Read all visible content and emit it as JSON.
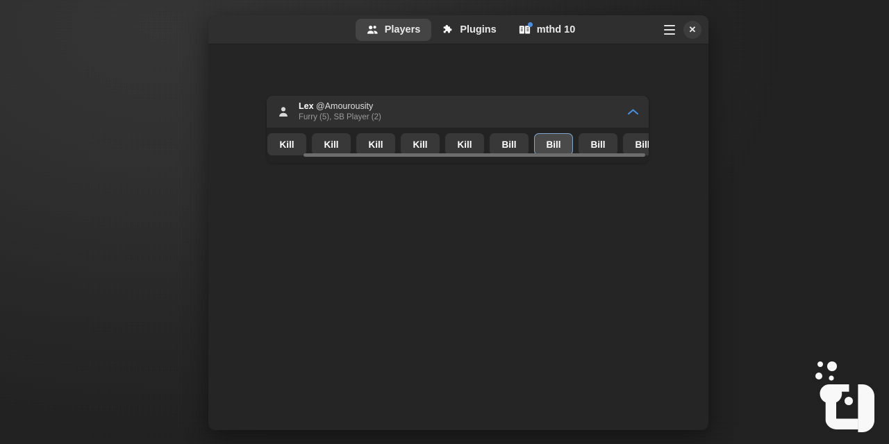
{
  "window": {
    "tabs": [
      {
        "label": "Players",
        "icon": "people-icon",
        "active": true,
        "badge": false
      },
      {
        "label": "Plugins",
        "icon": "puzzle-icon",
        "active": false,
        "badge": false
      },
      {
        "label": "mthd 10",
        "icon": "book-icon",
        "active": false,
        "badge": true
      }
    ],
    "controls": {
      "menu_label": "☰",
      "close_label": "✕"
    }
  },
  "player_card": {
    "nickname": "Lex",
    "handle": "@Amourousity",
    "subtitle": "Furry (5), SB Player (2)",
    "expanded": true,
    "collapse_icon": "chevron-up-icon",
    "avatar_icon": "person-icon",
    "actions": [
      {
        "label": "Kill",
        "focused": false
      },
      {
        "label": "Kill",
        "focused": false
      },
      {
        "label": "Kill",
        "focused": false
      },
      {
        "label": "Kill",
        "focused": false
      },
      {
        "label": "Kill",
        "focused": false
      },
      {
        "label": "Bill",
        "focused": false
      },
      {
        "label": "Bill",
        "focused": true
      },
      {
        "label": "Bill",
        "focused": false
      },
      {
        "label": "Bill",
        "focused": false
      }
    ]
  },
  "colors": {
    "accent": "#4a90e2",
    "focus_border": "#81a7cf",
    "window_bg": "#252525",
    "titlebar_bg": "#2f2f2f",
    "active_tab_bg": "#444444",
    "button_bg": "#383838"
  },
  "watermark": {
    "name": "app-logo-watermark"
  }
}
